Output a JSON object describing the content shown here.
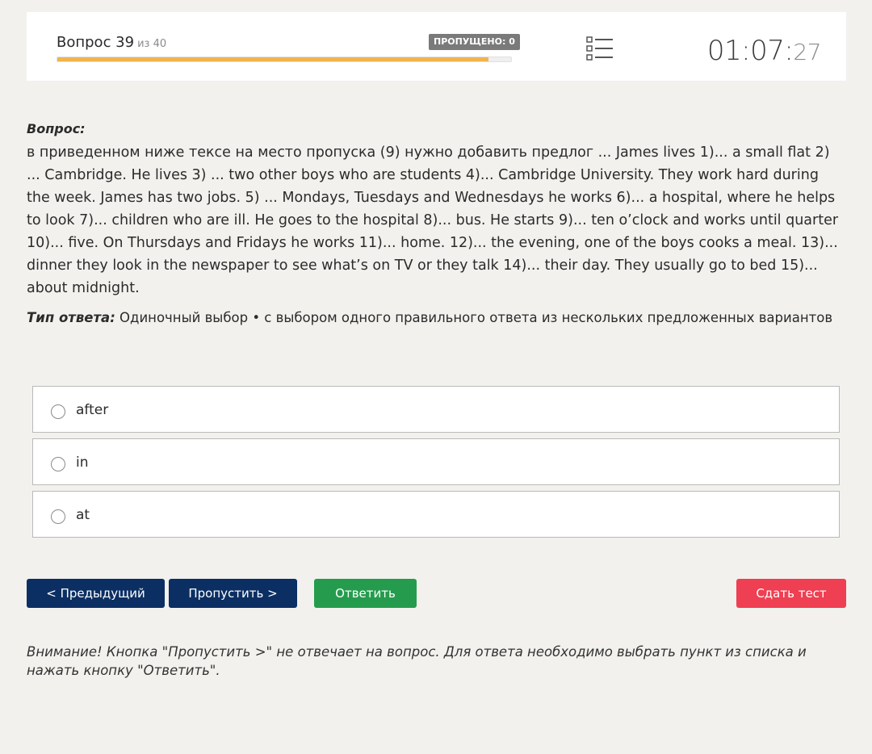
{
  "header": {
    "question_label": "Вопрос 39",
    "question_total": "из 40",
    "skipped_badge": "ПРОПУЩЕНО: 0",
    "progress_fraction": 0.95,
    "timer_main": "01:07:",
    "timer_seconds": "27",
    "list_icon": "list-icon"
  },
  "question": {
    "label": "Вопрос:",
    "text": "в приведенном ниже тексе на место пропуска (9) нужно добавить предлог ... James lives 1)... a small flat 2) ... Cambridge. He lives 3) ... two other boys who are students 4)... Cambridge University. They work hard during the week. James has two jobs. 5) ... Mondays, Tuesdays and Wednesdays he works 6)... a hospital, where he helps to look 7)... children who are ill. He goes to the hospital 8)... bus. He starts 9)... ten o’clock and works until quarter 10)... five. On Thursdays and Fridays he works 11)... home. 12)... the evening, one of the boys cooks a meal. 13)... dinner they look in the newspaper to see what’s on TV or they talk 14)... their day. They usually go to bed 15)... about midnight."
  },
  "answer_type": {
    "label": "Тип ответа:",
    "value": "Одиночный выбор • с выбором одного правильного ответа из нескольких предложенных вариантов"
  },
  "options": [
    "after",
    "in",
    "at"
  ],
  "buttons": {
    "prev": "< Предыдущий",
    "skip": "Пропустить >",
    "answer": "Ответить",
    "submit": "Сдать тест"
  },
  "notice": "Внимание! Кнопка \"Пропустить >\" не отвечает на вопрос. Для ответа необходимо выбрать пункт из списка и нажать кнопку \"Ответить\".",
  "colors": {
    "navy": "#0b2f63",
    "green": "#259c4d",
    "red": "#ef3f52",
    "progress": "#f0b44c"
  }
}
